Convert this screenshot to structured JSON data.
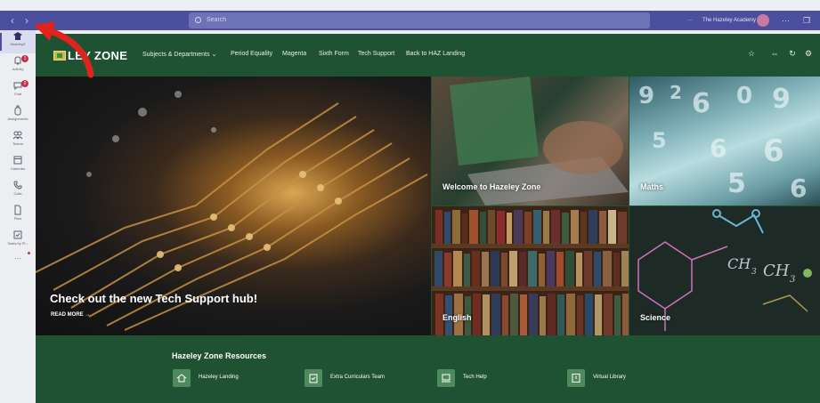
{
  "titlebar": {
    "back_glyph": "‹",
    "forward_glyph": "›",
    "search_placeholder": "Search",
    "org_more": "···",
    "org_name": "The Hazeley Academy",
    "win_more": "···",
    "win_restore": "❐"
  },
  "rail": {
    "items": [
      {
        "label": "HazeleyZ",
        "icon": "school-icon"
      },
      {
        "label": "Activity",
        "icon": "bell-icon",
        "badge": "1"
      },
      {
        "label": "Chat",
        "icon": "chat-icon",
        "badge": "2"
      },
      {
        "label": "Assignments",
        "icon": "backpack-icon"
      },
      {
        "label": "Teams",
        "icon": "teams-icon"
      },
      {
        "label": "Calendar",
        "icon": "calendar-icon"
      },
      {
        "label": "Calls",
        "icon": "phone-icon"
      },
      {
        "label": "Files",
        "icon": "file-icon"
      },
      {
        "label": "Tasks by Pl...",
        "icon": "tasks-icon"
      }
    ],
    "more_glyph": "···"
  },
  "site": {
    "title": "HAZELEY ZONE",
    "title_visible": "LEY ZONE",
    "nav": {
      "subjects": "Subjects & Departments",
      "subjects_chevron": "⌄",
      "period": "Period Equality",
      "magenta": "Magenta",
      "sixth": "Sixth Form",
      "tech": "Tech Support",
      "back": "Back to HAZ Landing"
    },
    "actions": {
      "star": "☆",
      "share": "⇔",
      "refresh": "↻",
      "settings": "⚙"
    }
  },
  "hero": {
    "main_caption": "Check out the new Tech Support hub!",
    "read_more": "READ MORE →",
    "welcome": "Welcome to Hazeley Zone",
    "maths": "Maths",
    "english": "English",
    "science": "Science"
  },
  "resources": {
    "title": "Hazeley Zone Resources",
    "items": [
      {
        "label": "Hazeley Landing",
        "icon": "home-icon"
      },
      {
        "label": "Extra Curriculars Team",
        "icon": "clipboard-icon"
      },
      {
        "label": "Tech Help",
        "icon": "laptop-icon"
      },
      {
        "label": "Virtual Library",
        "icon": "book-icon"
      }
    ]
  },
  "colors": {
    "teams_purple": "#4b4f9e",
    "site_green": "#1f5133",
    "badge_red": "#c4314b",
    "annotation_red": "#e0231d"
  }
}
